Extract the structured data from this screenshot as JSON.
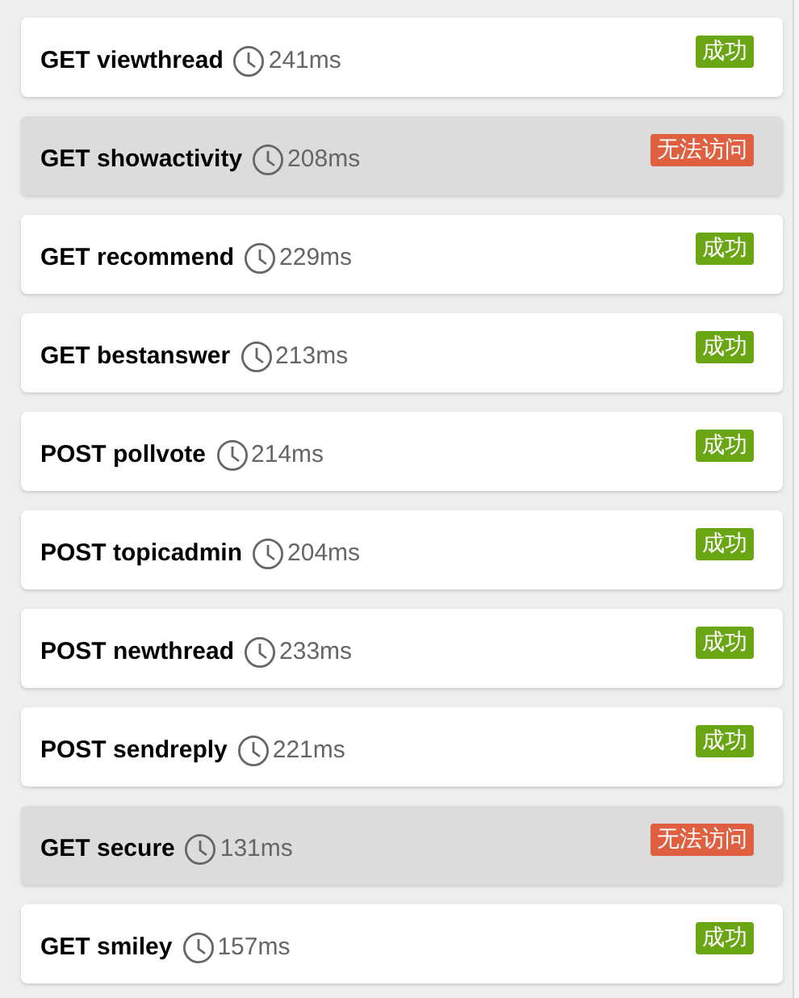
{
  "requests": [
    {
      "name": "GET viewthread",
      "time": "241ms",
      "status": "成功",
      "kind": "success"
    },
    {
      "name": "GET showactivity",
      "time": "208ms",
      "status": "无法访问",
      "kind": "error"
    },
    {
      "name": "GET recommend",
      "time": "229ms",
      "status": "成功",
      "kind": "success"
    },
    {
      "name": "GET bestanswer",
      "time": "213ms",
      "status": "成功",
      "kind": "success"
    },
    {
      "name": "POST pollvote",
      "time": "214ms",
      "status": "成功",
      "kind": "success"
    },
    {
      "name": "POST topicadmin",
      "time": "204ms",
      "status": "成功",
      "kind": "success"
    },
    {
      "name": "POST newthread",
      "time": "233ms",
      "status": "成功",
      "kind": "success"
    },
    {
      "name": "POST sendreply",
      "time": "221ms",
      "status": "成功",
      "kind": "success"
    },
    {
      "name": "GET secure",
      "time": "131ms",
      "status": "无法访问",
      "kind": "error"
    },
    {
      "name": "GET smiley",
      "time": "157ms",
      "status": "成功",
      "kind": "success"
    }
  ]
}
